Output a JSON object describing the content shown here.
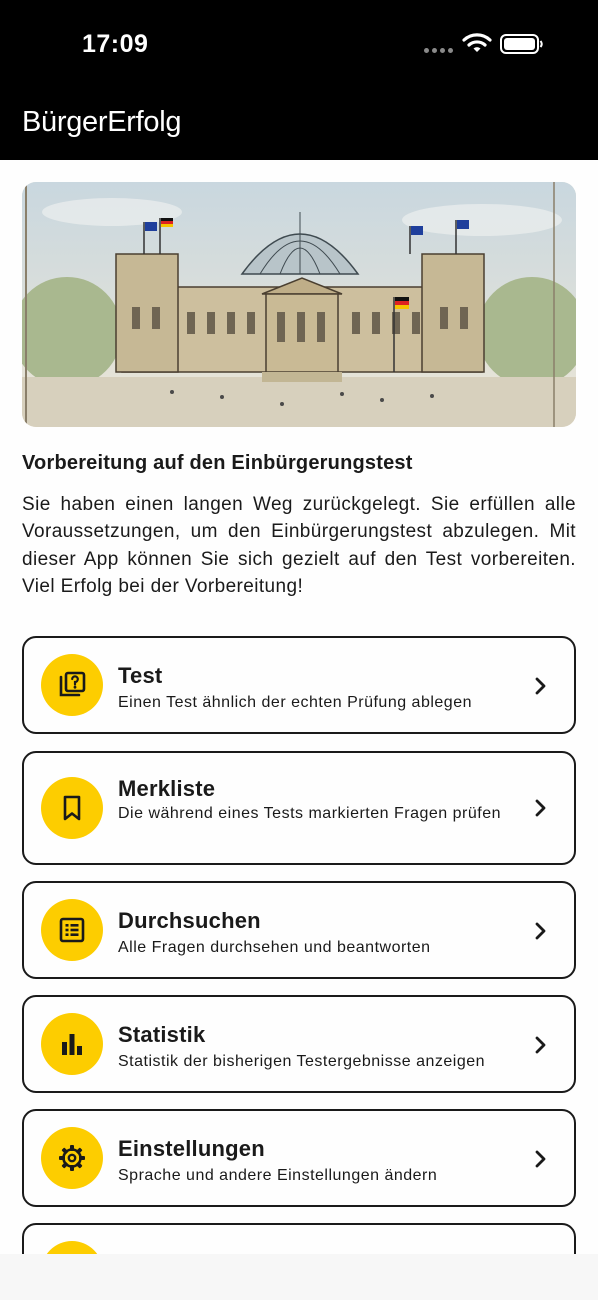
{
  "status_bar": {
    "time": "17:09",
    "icons": [
      "signal-dots-icon",
      "wifi-icon",
      "battery-icon"
    ]
  },
  "app_bar": {
    "title": "BürgerErfolg"
  },
  "hero_image": {
    "subject": "reichstag-building-sketch"
  },
  "intro": {
    "title": "Vorbereitung auf den Einbürgerungstest",
    "text": "Sie haben einen langen Weg zurückgelegt. Sie erfüllen alle Voraussetzungen, um den Einbürgerungstest abzulegen. Mit dieser App können Sie sich gezielt auf den Test vorbereiten. Viel Erfolg bei der Vorbereitung!"
  },
  "menu": [
    {
      "title": "Test",
      "subtitle": "Einen Test ähnlich der echten Prüfung ablegen",
      "icon": "quiz-icon"
    },
    {
      "title": "Merkliste",
      "subtitle": "Die während eines Tests markierten Fragen prüfen",
      "icon": "bookmark-icon"
    },
    {
      "title": "Durchsuchen",
      "subtitle": "Alle Fragen durchsehen und beantworten",
      "icon": "list-icon"
    },
    {
      "title": "Statistik",
      "subtitle": "Statistik der bisherigen Testergebnisse anzeigen",
      "icon": "bar-chart-icon"
    },
    {
      "title": "Einstellungen",
      "subtitle": "Sprache und andere Einstellungen ändern",
      "icon": "gear-icon"
    },
    {
      "title": "",
      "subtitle": "",
      "icon": "info-icon"
    }
  ],
  "colors": {
    "accent": "#fdcd00",
    "bar": "#000000",
    "text": "#1a1a1a"
  }
}
